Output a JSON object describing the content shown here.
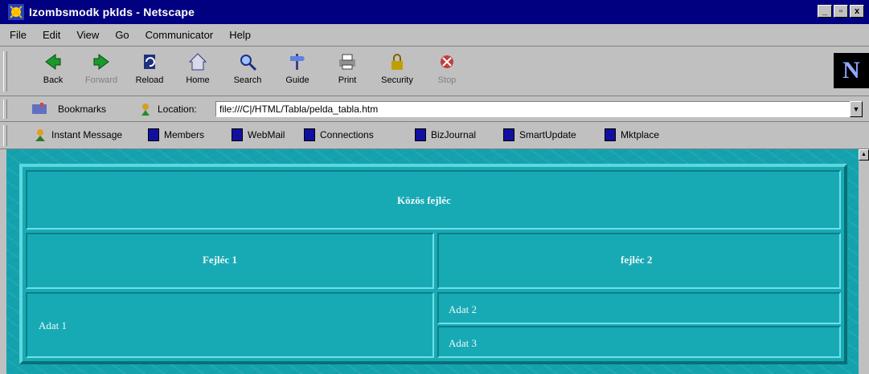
{
  "window": {
    "title": "Izombsmodk pklds - Netscape",
    "buttons": [
      "_",
      "▫",
      "x"
    ]
  },
  "menu": [
    "File",
    "Edit",
    "View",
    "Go",
    "Communicator",
    "Help"
  ],
  "toolbar": {
    "buttons": [
      {
        "label": "Back",
        "icon": "back-arrow-icon"
      },
      {
        "label": "Forward",
        "icon": "forward-arrow-icon"
      },
      {
        "label": "Reload",
        "icon": "reload-icon"
      },
      {
        "label": "Home",
        "icon": "home-icon"
      },
      {
        "label": "Search",
        "icon": "search-icon"
      },
      {
        "label": "Guide",
        "icon": "guide-icon"
      },
      {
        "label": "Print",
        "icon": "print-icon"
      },
      {
        "label": "Security",
        "icon": "security-icon"
      },
      {
        "label": "Stop",
        "icon": "stop-icon"
      }
    ],
    "logo": "N"
  },
  "location": {
    "bookmarks_label": "Bookmarks",
    "location_label": "Location:",
    "url": "file:///C|/HTML/Tabla/pelda_tabla.htm"
  },
  "personal": [
    "Instant Message",
    "Members",
    "WebMail",
    "Connections",
    "BizJournal",
    "SmartUpdate",
    "Mktplace"
  ],
  "table": {
    "header": "Közös fejléc",
    "col1_header": "Fejléc 1",
    "col2_header": "fejléc 2",
    "left_cell": "Adat 1",
    "right_cell_1": "Adat 2",
    "right_cell_2": "Adat 3"
  },
  "colors": {
    "page_bg": "#14a3ae",
    "title_bar": "#000080"
  }
}
